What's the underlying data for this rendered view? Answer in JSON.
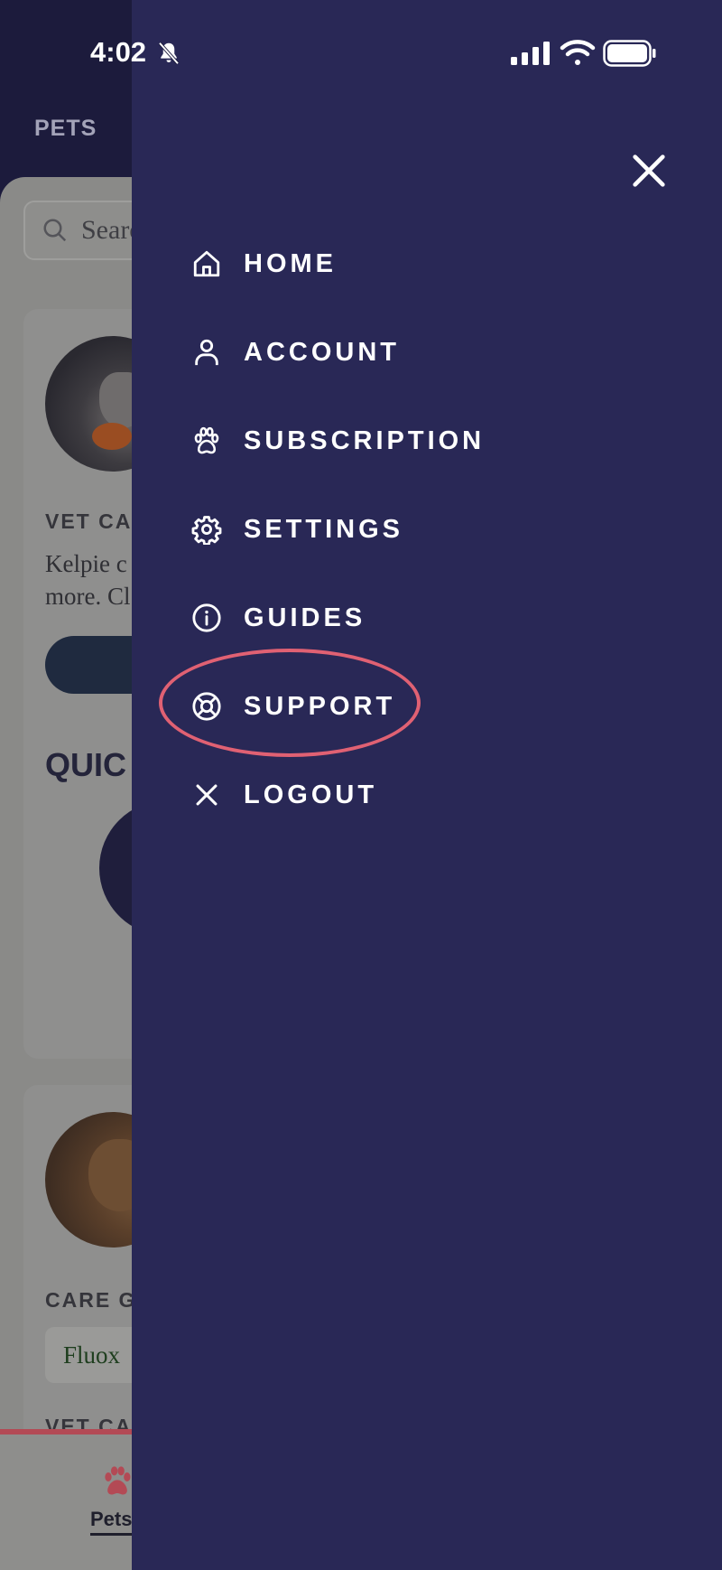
{
  "status_bar": {
    "time": "4:02"
  },
  "background_app": {
    "header_title": "PETS",
    "search_placeholder": "Search",
    "cards": [
      {
        "label": "VET CA",
        "text_lines": [
          "Kelpie c",
          "more. Cl"
        ]
      },
      {
        "label": "CARE G",
        "chip": "Fluox",
        "label2": "VET CA"
      }
    ],
    "quick_title": "QUIC",
    "bottom_nav": {
      "pets_label": "Pets"
    }
  },
  "drawer": {
    "menu": [
      {
        "label": "HOME",
        "icon": "home-icon"
      },
      {
        "label": "ACCOUNT",
        "icon": "user-icon"
      },
      {
        "label": "SUBSCRIPTION",
        "icon": "paw-icon"
      },
      {
        "label": "SETTINGS",
        "icon": "gear-icon"
      },
      {
        "label": "GUIDES",
        "icon": "info-icon"
      },
      {
        "label": "SUPPORT",
        "icon": "lifebuoy-icon"
      },
      {
        "label": "LOGOUT",
        "icon": "close-icon"
      }
    ],
    "highlighted_item": "SUPPORT"
  },
  "colors": {
    "drawer_bg": "#292856",
    "highlight_ring": "#e06173",
    "text": "#ffffff"
  }
}
